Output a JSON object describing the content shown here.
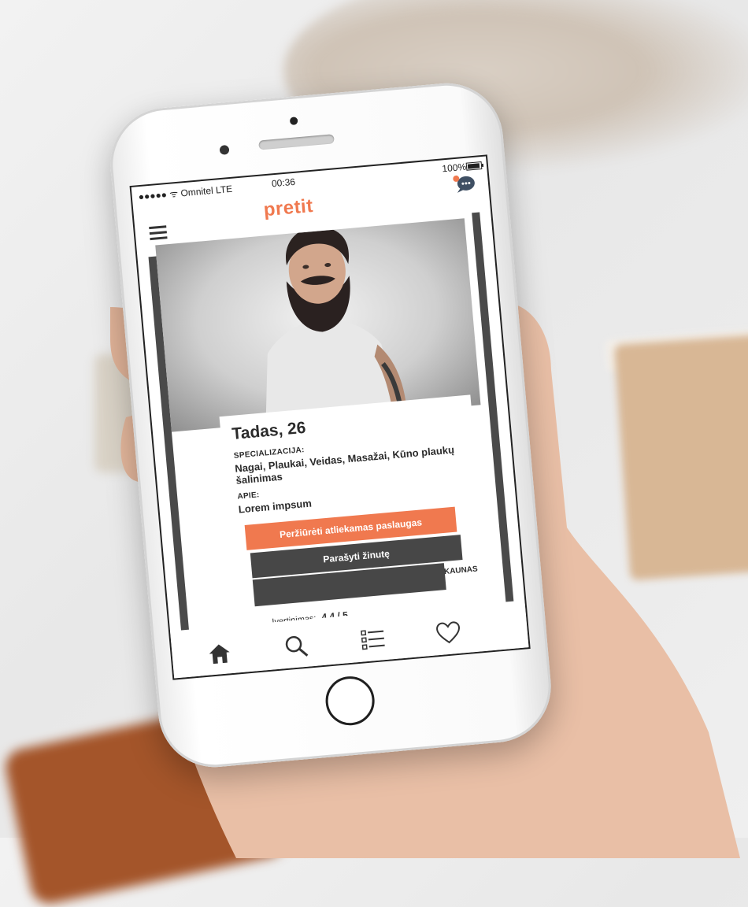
{
  "status_bar": {
    "carrier": "●●●●● ᯤ Omnitel LTE",
    "time": "00:36",
    "battery": "100%"
  },
  "app": {
    "logo": "pretit",
    "profile": {
      "name": "Tadas, 26",
      "specialization_label": "SPECIALIZACIJA:",
      "specialization": "Nagai, Plaukai, Veidas, Masažai, Kūno plaukų šalinimas",
      "about_label": "APIE:",
      "about": "Lorem impsum",
      "city": "KAUNAS",
      "rating_label": "Įvertinimas:",
      "rating": "4.4 / 5"
    },
    "buttons": {
      "view_services": "Peržiūrėti atliekamas paslaugas",
      "write_message": "Parašyti žinutę"
    },
    "tabs": [
      "home-icon",
      "search-icon",
      "list-icon",
      "heart-icon"
    ]
  },
  "colors": {
    "accent": "#f0794f",
    "dark": "#474747"
  }
}
